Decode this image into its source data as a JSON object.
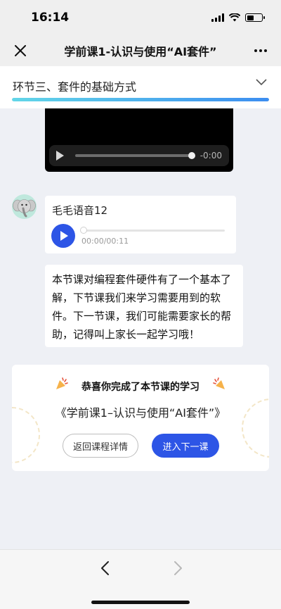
{
  "status_bar": {
    "time": "16:14"
  },
  "nav": {
    "title": "学前课1-认识与使用“AI套件”"
  },
  "section": {
    "title": "环节三、套件的基础方式",
    "progress": 1.0
  },
  "video": {
    "time": "-0:00"
  },
  "audio": {
    "title": "毛毛语音12",
    "time": "00:00/00:11"
  },
  "message": {
    "text": "本节课对编程套件硬件有了一个基本了解，下节课我们来学习需要用到的软件。下一节课，我们可能需要家长的帮助，记得叫上家长一起学习哦！"
  },
  "completion": {
    "title": "恭喜你完成了本节课的学习",
    "course": "《学前课1–认识与使用“AI套件”》",
    "back_label": "返回课程详情",
    "next_label": "进入下一课"
  },
  "colors": {
    "accent": "#2d55e6",
    "progress_start": "#62d6e8",
    "progress_end": "#3c8df0"
  }
}
